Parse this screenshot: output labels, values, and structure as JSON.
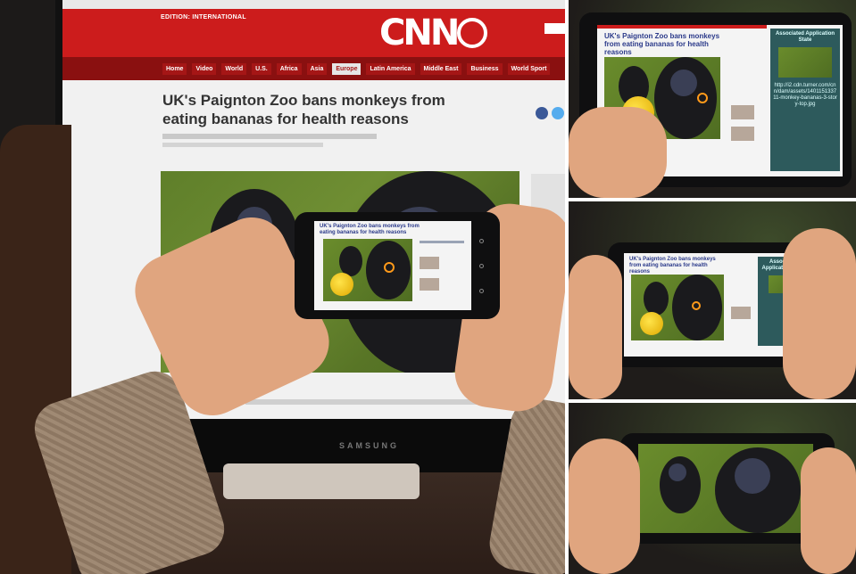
{
  "main_photo": {
    "monitor": {
      "edition_label": "EDITION: INTERNATIONAL",
      "logo": "CNN",
      "nav_items": [
        "Home",
        "Video",
        "World",
        "U.S.",
        "Africa",
        "Asia",
        "Europe",
        "Latin America",
        "Middle East",
        "Business",
        "World Sport"
      ],
      "active_nav_index": 6,
      "headline": "UK's Paignton Zoo bans monkeys from eating bananas for health reasons",
      "brand": "SAMSUNG"
    },
    "phone": {
      "mini_headline": "UK's Paignton Zoo bans monkeys from eating bananas for health reasons"
    }
  },
  "side_panels": [
    {
      "headline": "UK's Paignton Zoo bans monkeys from eating bananas for health reasons",
      "state_box": {
        "title": "Associated Application State",
        "url": "http://i2.cdn.turner.com/cnn/dam/assets/140115133711-monkey-bananas-3-story-top.jpg"
      }
    },
    {
      "headline": "UK's Paignton Zoo bans monkeys from eating bananas for health reasons",
      "state_box": {
        "title": "Associated Application State"
      }
    },
    {}
  ],
  "colors": {
    "cnn_red": "#cc1c1c",
    "state_box_bg": "#2d5a5c",
    "ball_yellow": "#ffd21a",
    "ring_orange": "#ff9a1a"
  }
}
